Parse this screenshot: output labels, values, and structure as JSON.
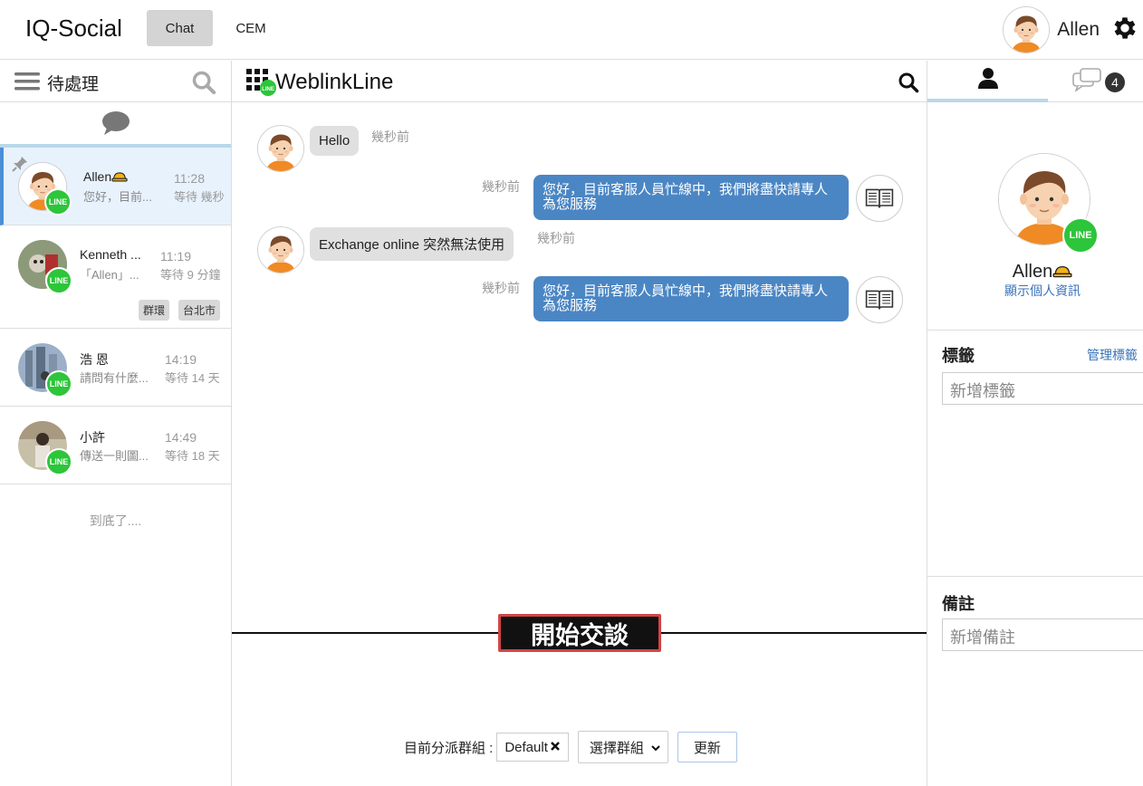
{
  "header": {
    "brand": "IQ-Social",
    "tabs": [
      {
        "label": "Chat",
        "active": true
      },
      {
        "label": "CEM",
        "active": false
      }
    ],
    "user_name": "Allen",
    "icons": [
      "gear-icon"
    ]
  },
  "left_panel": {
    "title": "待處理",
    "conversations": [
      {
        "name": "Allen",
        "name_icon": "hardhat-icon",
        "preview": "您好，目前...",
        "time": "11:28",
        "wait": "等待 幾秒",
        "pinned": true,
        "active": true,
        "tags": []
      },
      {
        "name": "Kenneth ...",
        "preview": "「Allen」...",
        "time": "11:19",
        "wait": "等待 9 分鐘",
        "pinned": false,
        "active": false,
        "tags": [
          "群環",
          "台北市"
        ]
      },
      {
        "name": "浩 恩",
        "preview": "請問有什麼...",
        "time": "14:19",
        "wait": "等待 14 天",
        "pinned": false,
        "active": false,
        "tags": []
      },
      {
        "name": "小許",
        "preview": "傳送一則圖...",
        "time": "14:49",
        "wait": "等待 18 天",
        "pinned": false,
        "active": false,
        "tags": []
      }
    ],
    "end_text": "到底了....",
    "badge_label": "LINE"
  },
  "chat": {
    "channel_title": "WeblinkLine",
    "messages": [
      {
        "direction": "in",
        "text": "Hello",
        "stamp": "幾秒前"
      },
      {
        "direction": "out",
        "text": "您好，目前客服人員忙線中，我們將盡快請專人為您服務",
        "stamp": "幾秒前"
      },
      {
        "direction": "in",
        "text": "Exchange online 突然無法使用",
        "stamp": "幾秒前"
      },
      {
        "direction": "out",
        "text": "您好，目前客服人員忙線中，我們將盡快請專人為您服務",
        "stamp": "幾秒前"
      }
    ],
    "start_button": "開始交談",
    "group_label": "目前分派群組 :",
    "group_value": "Default",
    "select_label": "選擇群組",
    "update_button": "更新"
  },
  "right_panel": {
    "unread_count": "4",
    "profile_name": "Allen",
    "profile_link": "顯示個人資訊",
    "tags_title": "標籤",
    "tags_manage": "管理標籤",
    "tags_placeholder": "新增標籤",
    "notes_title": "備註",
    "notes_placeholder": "新增備註"
  },
  "colors": {
    "accent_blue": "#4b86c4",
    "line_green": "#2dc53a",
    "start_button_border": "#d24545",
    "tab_underline": "#b8d8ea"
  }
}
